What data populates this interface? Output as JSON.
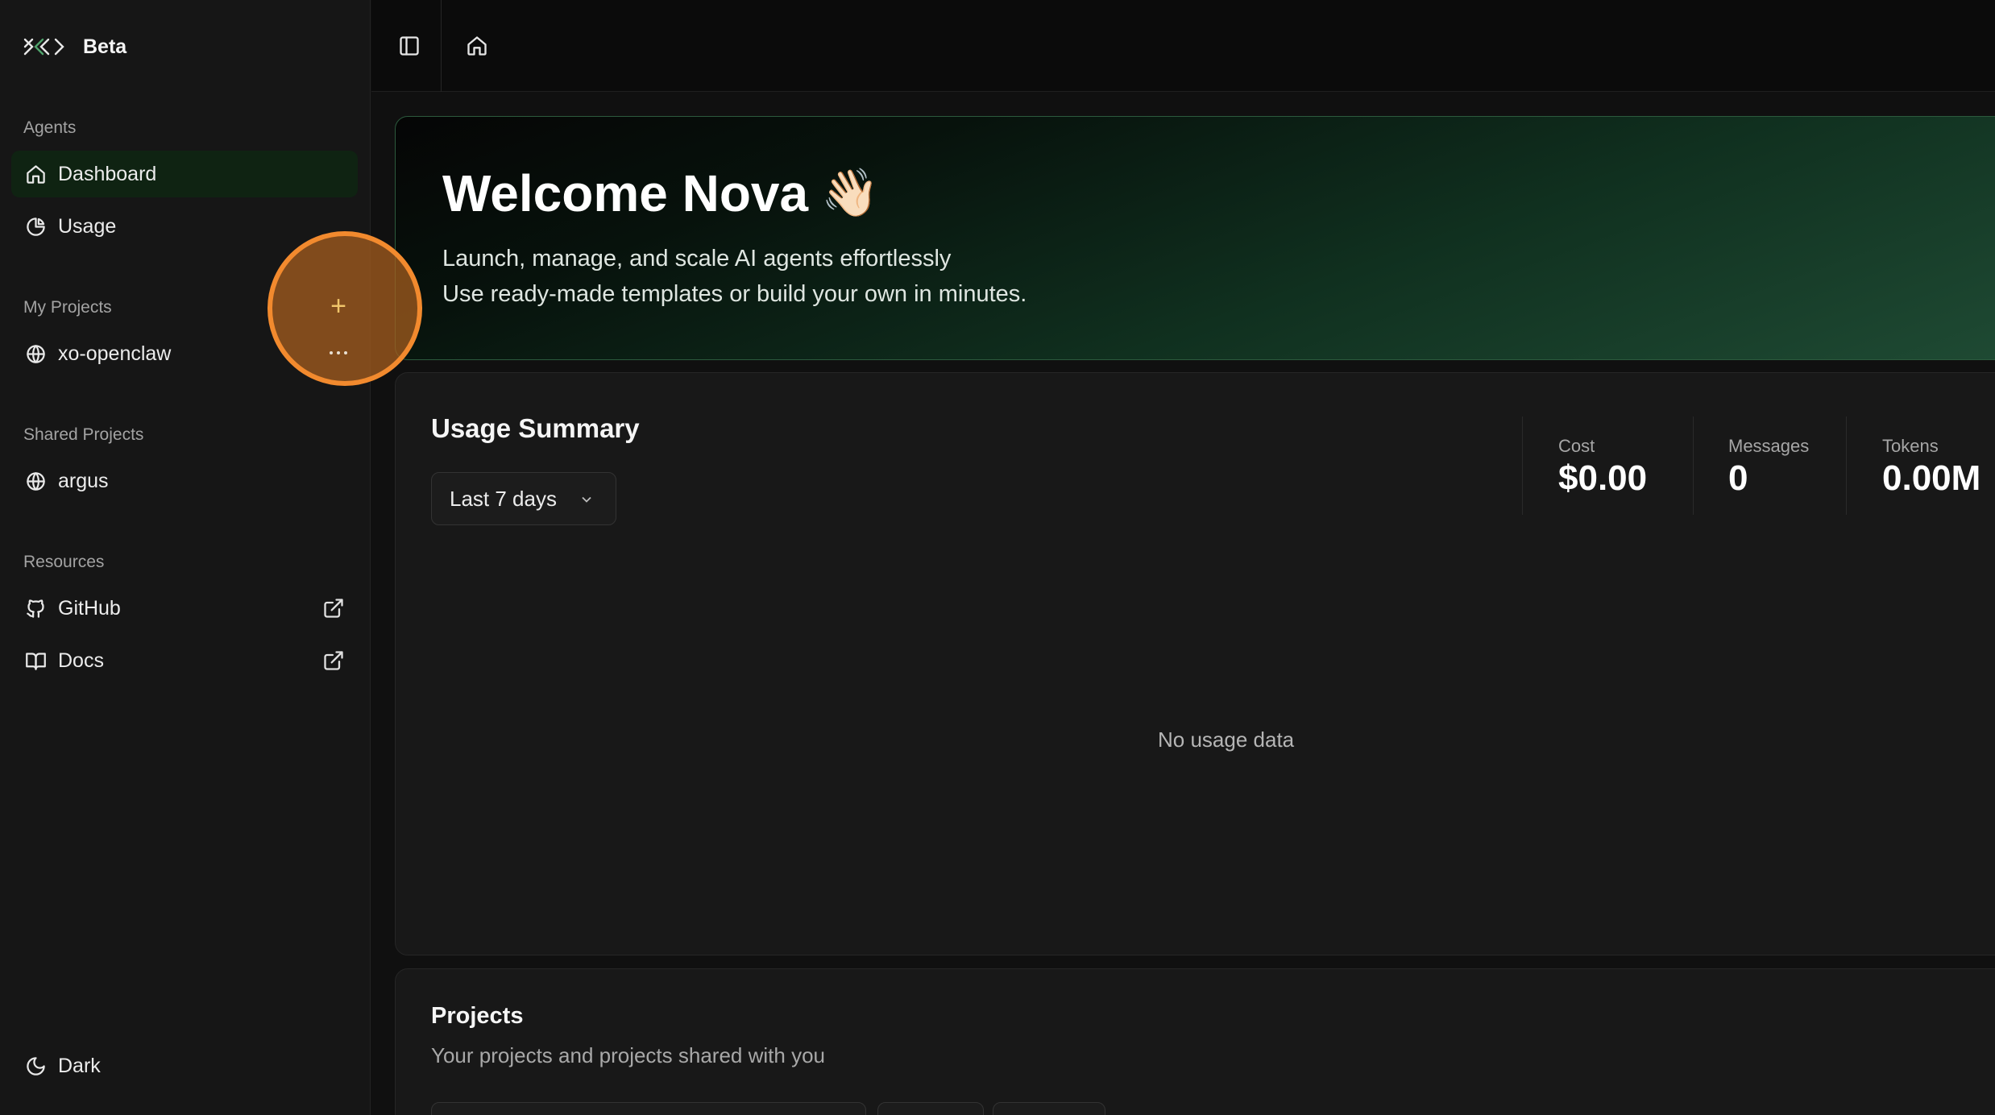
{
  "sidebar": {
    "brand_label": "Beta",
    "sections": {
      "agents": "Agents",
      "my_projects": "My Projects",
      "shared_projects": "Shared Projects",
      "resources": "Resources"
    },
    "items": {
      "dashboard": "Dashboard",
      "usage": "Usage",
      "project_xo": "xo-openclaw",
      "project_argus": "argus",
      "github": "GitHub",
      "docs": "Docs",
      "theme": "Dark"
    },
    "add_label": "+"
  },
  "hero": {
    "title": "Welcome Nova",
    "emoji": "👋🏻",
    "line1": "Launch, manage, and scale AI agents effortlessly",
    "line2": "Use ready-made templates or build your own in minutes."
  },
  "usage": {
    "title": "Usage Summary",
    "range_selected": "Last 7 days",
    "stats": {
      "cost_label": "Cost",
      "cost_value": "$0.00",
      "messages_label": "Messages",
      "messages_value": "0",
      "tokens_label": "Tokens",
      "tokens_value": "0.00M"
    },
    "empty_text": "No usage data"
  },
  "projects": {
    "title": "Projects",
    "subtitle": "Your projects and projects shared with you"
  },
  "colors": {
    "accent_highlight": "#f28a2e",
    "active_nav_bg": "#0f2312",
    "hero_border": "#2c5a3d"
  },
  "icons": {
    "brand": "xo-logo-icon",
    "dashboard": "home-icon",
    "usage": "pie-chart-icon",
    "project": "globe-icon",
    "github": "github-icon",
    "docs": "book-open-icon",
    "external": "external-link-icon",
    "theme": "moon-icon",
    "sidebar_toggle": "panel-left-icon",
    "home": "home-icon"
  }
}
